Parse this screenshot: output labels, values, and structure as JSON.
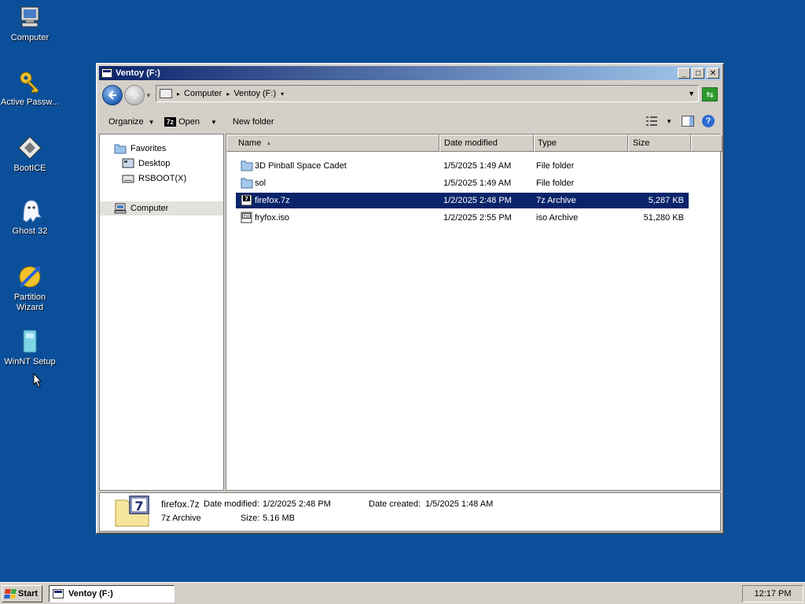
{
  "desktop": {
    "icons": [
      {
        "label": "Computer",
        "icon": "computer-icon"
      },
      {
        "label": "Active Passw...",
        "icon": "key-icon"
      },
      {
        "label": "BootICE",
        "icon": "bootice-icon"
      },
      {
        "label": "Ghost 32",
        "icon": "ghost-icon"
      },
      {
        "label": "Partition Wizard",
        "icon": "partition-wizard-icon"
      },
      {
        "label": "WinNT Setup",
        "icon": "winnt-setup-icon"
      }
    ]
  },
  "window": {
    "title": "Ventoy (F:)",
    "controls": {
      "minimize": "_",
      "maximize": "□",
      "close": "✕"
    },
    "breadcrumb": [
      "Computer",
      "Ventoy (F:)"
    ],
    "toolbar": {
      "organize": "Organize",
      "open": "Open",
      "new_folder": "New folder"
    },
    "nav": {
      "favorites": "Favorites",
      "desktop": "Desktop",
      "rsboot": "RSBOOT(X)",
      "computer": "Computer"
    },
    "columns": {
      "name": "Name",
      "date_modified": "Date modified",
      "type": "Type",
      "size": "Size"
    },
    "files": [
      {
        "name": "3D Pinball Space Cadet",
        "date": "1/5/2025 1:49 AM",
        "type": "File folder",
        "size": "",
        "icon": "folder-icon"
      },
      {
        "name": "sol",
        "date": "1/5/2025 1:49 AM",
        "type": "File folder",
        "size": "",
        "icon": "folder-icon"
      },
      {
        "name": "firefox.7z",
        "date": "1/2/2025 2:48 PM",
        "type": "7z Archive",
        "size": "5,287 KB",
        "icon": "7z-archive-icon",
        "selected": true
      },
      {
        "name": "fryfox.iso",
        "date": "1/2/2025 2:55 PM",
        "type": "iso Archive",
        "size": "51,280 KB",
        "icon": "iso-archive-icon"
      }
    ],
    "details": {
      "filename": "firefox.7z",
      "date_modified_label": "Date modified:",
      "date_modified": "1/2/2025 2:48 PM",
      "date_created_label": "Date created:",
      "date_created": "1/5/2025 1:48 AM",
      "type": "7z Archive",
      "size_label": "Size:",
      "size": "5.16 MB"
    }
  },
  "taskbar": {
    "start": "Start",
    "task": "Ventoy (F:)",
    "clock": "12:17 PM"
  },
  "colors": {
    "desktop": "#0b4f9a",
    "titlebar_start": "#0a246a",
    "titlebar_end": "#a6caf0",
    "selection": "#0a246a",
    "chrome": "#d4d0c8"
  }
}
